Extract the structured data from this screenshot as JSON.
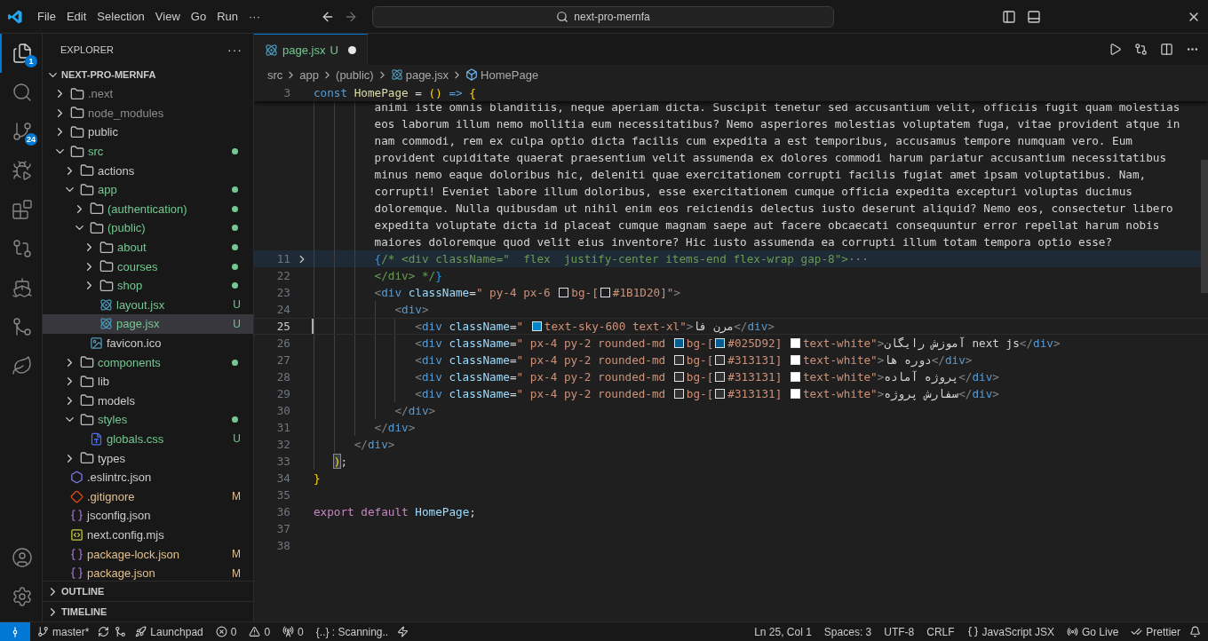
{
  "titlebar": {
    "menus": [
      "File",
      "Edit",
      "Selection",
      "View",
      "Go",
      "Run"
    ],
    "more": "···",
    "search": {
      "value": "next-pro-mernfa"
    }
  },
  "activity_bar": {
    "items": [
      {
        "kind": "explorer",
        "selected": true,
        "badge": "1"
      },
      {
        "kind": "search",
        "selected": false
      },
      {
        "kind": "source-control",
        "selected": false,
        "badge": "24"
      },
      {
        "kind": "run",
        "selected": false
      },
      {
        "kind": "extensions",
        "selected": false
      },
      {
        "kind": "remote",
        "selected": false
      },
      {
        "kind": "docker",
        "selected": false
      },
      {
        "kind": "git-graph",
        "selected": false
      },
      {
        "kind": "mongo",
        "selected": false
      }
    ],
    "bottom": [
      {
        "kind": "account",
        "selected": false
      },
      {
        "kind": "settings",
        "selected": false
      }
    ]
  },
  "sidebar": {
    "title": "EXPLORER",
    "more": "···",
    "project": {
      "name": "NEXT-PRO-MERNFA",
      "expanded": true
    },
    "tree": [
      {
        "name": ".next",
        "kind": "folder",
        "color": "#8c8c8c",
        "changes": false,
        "expanded": false,
        "selected": false
      },
      {
        "name": "node_modules",
        "kind": "folder",
        "color": "#8c8c8c",
        "changes": false,
        "expanded": false,
        "selected": false
      },
      {
        "name": "public",
        "kind": "folder",
        "color": "#cccccc",
        "changes": false,
        "expanded": false,
        "selected": false
      },
      {
        "name": "src",
        "kind": "folder",
        "color": "#73c991",
        "changes": true,
        "expanded": true,
        "selected": false,
        "children": [
          {
            "name": "actions",
            "kind": "folder",
            "color": "#cccccc",
            "changes": false,
            "expanded": false,
            "selected": false
          },
          {
            "name": "app",
            "kind": "folder",
            "color": "#73c991",
            "changes": true,
            "expanded": true,
            "selected": false,
            "children": [
              {
                "name": "(authentication)",
                "kind": "folder",
                "color": "#73c991",
                "changes": true,
                "expanded": false,
                "selected": false
              },
              {
                "name": "(public)",
                "kind": "folder",
                "color": "#73c991",
                "changes": true,
                "expanded": true,
                "selected": false,
                "children": [
                  {
                    "name": "about",
                    "kind": "folder",
                    "color": "#73c991",
                    "changes": true,
                    "expanded": false,
                    "selected": false
                  },
                  {
                    "name": "courses",
                    "kind": "folder",
                    "color": "#73c991",
                    "changes": true,
                    "expanded": false,
                    "selected": false
                  },
                  {
                    "name": "shop",
                    "kind": "folder",
                    "color": "#73c991",
                    "changes": true,
                    "expanded": false,
                    "selected": false
                  },
                  {
                    "name": "layout.jsx",
                    "kind": "react",
                    "color": "#73c991",
                    "changes": true,
                    "badge": "U",
                    "selected": false
                  },
                  {
                    "name": "page.jsx",
                    "kind": "react",
                    "color": "#73c991",
                    "changes": true,
                    "badge": "U",
                    "selected": true
                  }
                ]
              },
              {
                "name": "favicon.ico",
                "kind": "image",
                "color": "#cccccc",
                "changes": false,
                "selected": false
              }
            ]
          },
          {
            "name": "components",
            "kind": "folder",
            "color": "#73c991",
            "changes": true,
            "expanded": false,
            "selected": false
          },
          {
            "name": "lib",
            "kind": "folder",
            "color": "#cccccc",
            "changes": false,
            "expanded": false,
            "selected": false
          },
          {
            "name": "models",
            "kind": "folder",
            "color": "#cccccc",
            "changes": false,
            "expanded": false,
            "selected": false
          },
          {
            "name": "styles",
            "kind": "folder",
            "color": "#73c991",
            "changes": true,
            "expanded": true,
            "selected": false,
            "children": [
              {
                "name": "globals.css",
                "kind": "css",
                "color": "#73c991",
                "changes": true,
                "badge": "U",
                "selected": false
              }
            ]
          },
          {
            "name": "types",
            "kind": "folder",
            "color": "#cccccc",
            "changes": false,
            "expanded": false,
            "selected": false
          }
        ]
      },
      {
        "name": ".eslintrc.json",
        "kind": "eslint",
        "color": "#cccccc",
        "changes": false,
        "selected": false
      },
      {
        "name": ".gitignore",
        "kind": "git",
        "color": "#e2c08d",
        "changes": true,
        "badge": "M",
        "selected": false
      },
      {
        "name": "jsconfig.json",
        "kind": "json",
        "color": "#cccccc",
        "changes": false,
        "selected": false
      },
      {
        "name": "next.config.mjs",
        "kind": "js",
        "color": "#cccccc",
        "changes": false,
        "selected": false
      },
      {
        "name": "package-lock.json",
        "kind": "json",
        "color": "#e2c08d",
        "changes": true,
        "badge": "M",
        "selected": false
      },
      {
        "name": "package.json",
        "kind": "json",
        "color": "#e2c08d",
        "changes": true,
        "badge": "M",
        "selected": false
      }
    ],
    "sections": [
      {
        "title": "OUTLINE",
        "expanded": false
      },
      {
        "title": "TIMELINE",
        "expanded": false
      }
    ]
  },
  "editor": {
    "tabs": [
      {
        "name": "page.jsx",
        "kind": "react",
        "status": "U",
        "dirty": true,
        "selected": true
      }
    ],
    "breadcrumbs": [
      {
        "text": "src",
        "kind": "folder"
      },
      {
        "text": "app",
        "kind": "folder"
      },
      {
        "text": "(public)",
        "kind": "folder"
      },
      {
        "text": "page.jsx",
        "kind": "react"
      },
      {
        "text": "HomePage",
        "kind": "symbol"
      }
    ],
    "sticky_line": {
      "number": "3",
      "tokens": [
        {
          "kind": "keyword",
          "text": "const"
        },
        {
          "kind": "function",
          "text": " HomePage"
        },
        {
          "kind": "op",
          "text": " = "
        },
        {
          "kind": "bracket",
          "text": "()"
        },
        {
          "kind": "keyword",
          "text": " => "
        },
        {
          "kind": "bracket",
          "text": "{"
        }
      ]
    },
    "lines": [
      {
        "current": false,
        "folded": false,
        "tokens": [
          {
            "kind": "text",
            "text": "         animi iste omnis blanditiis, neque aperiam dicta. Suscipit tenetur sed accusantium velit, officiis fugit quam molestias"
          }
        ]
      },
      {
        "current": false,
        "folded": false,
        "tokens": [
          {
            "kind": "text",
            "text": "         eos laborum illum nemo mollitia eum necessitatibus? Nemo asperiores molestias voluptatem fuga, vitae provident atque in"
          }
        ]
      },
      {
        "current": false,
        "folded": false,
        "tokens": [
          {
            "kind": "text",
            "text": "         nam commodi, rem ex culpa optio dicta facilis cum expedita a est temporibus, accusamus tempore numquam vero. Eum"
          }
        ]
      },
      {
        "current": false,
        "folded": false,
        "tokens": [
          {
            "kind": "text",
            "text": "         provident cupiditate quaerat praesentium velit assumenda ex dolores commodi harum pariatur accusantium necessitatibus"
          }
        ]
      },
      {
        "current": false,
        "folded": false,
        "tokens": [
          {
            "kind": "text",
            "text": "         minus nemo eaque doloribus hic, deleniti quae exercitationem corrupti facilis fugiat amet ipsam voluptatibus. Nam,"
          }
        ]
      },
      {
        "current": false,
        "folded": false,
        "tokens": [
          {
            "kind": "text",
            "text": "         corrupti! Eveniet labore illum doloribus, esse exercitationem cumque officia expedita excepturi voluptas ducimus"
          }
        ]
      },
      {
        "current": false,
        "folded": false,
        "tokens": [
          {
            "kind": "text",
            "text": "         doloremque. Nulla quibusdam ut nihil enim eos reiciendis delectus iusto deserunt aliquid? Nemo eos, consectetur libero"
          }
        ]
      },
      {
        "current": false,
        "folded": false,
        "tokens": [
          {
            "kind": "text",
            "text": "         expedita voluptate dicta id placeat cumque magnam saepe aut facere obcaecati consequuntur error repellat harum nobis"
          }
        ]
      },
      {
        "current": false,
        "folded": false,
        "tokens": [
          {
            "kind": "text",
            "text": "         maiores doloremque quod velit eius inventore? Hic iusto assumenda ea corrupti illum totam tempora optio esse?"
          }
        ]
      },
      {
        "number": "11",
        "current": false,
        "folded": true,
        "tokens": [
          {
            "kind": "bracket2",
            "text": "         {"
          },
          {
            "kind": "comment",
            "text": "/* <div className=\"  flex  justify-center items-end flex-wrap gap-8\">"
          },
          {
            "kind": "fold",
            "text": "···"
          }
        ]
      },
      {
        "number": "22",
        "current": false,
        "folded": false,
        "tokens": [
          {
            "kind": "comment",
            "text": "         </div> */"
          },
          {
            "kind": "bracket2",
            "text": "}"
          }
        ]
      },
      {
        "number": "23",
        "current": false,
        "folded": false,
        "tokens": [
          {
            "kind": "angle",
            "text": "         <"
          },
          {
            "kind": "tag",
            "text": "div"
          },
          {
            "kind": "attr",
            "text": " className"
          },
          {
            "kind": "op",
            "text": "="
          },
          {
            "kind": "string",
            "text": "\" py-4 px-6 "
          },
          {
            "kind": "swatch",
            "color": "#1b1d20"
          },
          {
            "kind": "string",
            "text": "bg-["
          },
          {
            "kind": "swatch",
            "color": "#1b1d20"
          },
          {
            "kind": "string",
            "text": "#1B1D20]\""
          },
          {
            "kind": "angle",
            "text": ">"
          }
        ]
      },
      {
        "number": "24",
        "current": false,
        "folded": false,
        "tokens": [
          {
            "kind": "angle",
            "text": "            <"
          },
          {
            "kind": "tag",
            "text": "div"
          },
          {
            "kind": "angle",
            "text": ">"
          }
        ]
      },
      {
        "number": "25",
        "current": true,
        "folded": false,
        "tokens": [
          {
            "kind": "angle",
            "text": "               <"
          },
          {
            "kind": "tag",
            "text": "div"
          },
          {
            "kind": "attr",
            "text": " className"
          },
          {
            "kind": "op",
            "text": "="
          },
          {
            "kind": "string",
            "text": "\" "
          },
          {
            "kind": "swatch",
            "color": "#0284c7"
          },
          {
            "kind": "string",
            "text": "text-sky-600 text-xl\""
          },
          {
            "kind": "angle",
            "text": ">"
          },
          {
            "kind": "text",
            "text": "مرن فا"
          },
          {
            "kind": "angle",
            "text": "</"
          },
          {
            "kind": "tag",
            "text": "div"
          },
          {
            "kind": "angle",
            "text": ">"
          }
        ]
      },
      {
        "number": "26",
        "current": false,
        "folded": false,
        "tokens": [
          {
            "kind": "angle",
            "text": "               <"
          },
          {
            "kind": "tag",
            "text": "div"
          },
          {
            "kind": "attr",
            "text": " className"
          },
          {
            "kind": "op",
            "text": "="
          },
          {
            "kind": "string",
            "text": "\" px-4 py-2 rounded-md "
          },
          {
            "kind": "swatch",
            "color": "#025d92"
          },
          {
            "kind": "string",
            "text": "bg-["
          },
          {
            "kind": "swatch",
            "color": "#025d92"
          },
          {
            "kind": "string",
            "text": "#025D92] "
          },
          {
            "kind": "swatch",
            "color": "#ffffff"
          },
          {
            "kind": "string",
            "text": "text-white\""
          },
          {
            "kind": "angle",
            "text": ">"
          },
          {
            "kind": "text",
            "text": "آموزش رایگان next js"
          },
          {
            "kind": "angle",
            "text": "</"
          },
          {
            "kind": "tag",
            "text": "div"
          },
          {
            "kind": "angle",
            "text": ">"
          }
        ]
      },
      {
        "number": "27",
        "current": false,
        "folded": false,
        "tokens": [
          {
            "kind": "angle",
            "text": "               <"
          },
          {
            "kind": "tag",
            "text": "div"
          },
          {
            "kind": "attr",
            "text": " className"
          },
          {
            "kind": "op",
            "text": "="
          },
          {
            "kind": "string",
            "text": "\" px-4 py-2 rounded-md "
          },
          {
            "kind": "swatch",
            "color": "#313131"
          },
          {
            "kind": "string",
            "text": "bg-["
          },
          {
            "kind": "swatch",
            "color": "#313131"
          },
          {
            "kind": "string",
            "text": "#313131] "
          },
          {
            "kind": "swatch",
            "color": "#ffffff"
          },
          {
            "kind": "string",
            "text": "text-white\""
          },
          {
            "kind": "angle",
            "text": ">"
          },
          {
            "kind": "text",
            "text": "دوره ها"
          },
          {
            "kind": "angle",
            "text": "</"
          },
          {
            "kind": "tag",
            "text": "div"
          },
          {
            "kind": "angle",
            "text": ">"
          }
        ]
      },
      {
        "number": "28",
        "current": false,
        "folded": false,
        "tokens": [
          {
            "kind": "angle",
            "text": "               <"
          },
          {
            "kind": "tag",
            "text": "div"
          },
          {
            "kind": "attr",
            "text": " className"
          },
          {
            "kind": "op",
            "text": "="
          },
          {
            "kind": "string",
            "text": "\" px-4 py-2 rounded-md "
          },
          {
            "kind": "swatch",
            "color": "#313131"
          },
          {
            "kind": "string",
            "text": "bg-["
          },
          {
            "kind": "swatch",
            "color": "#313131"
          },
          {
            "kind": "string",
            "text": "#313131] "
          },
          {
            "kind": "swatch",
            "color": "#ffffff"
          },
          {
            "kind": "string",
            "text": "text-white\""
          },
          {
            "kind": "angle",
            "text": ">"
          },
          {
            "kind": "text",
            "text": "پروژه آماده"
          },
          {
            "kind": "angle",
            "text": "</"
          },
          {
            "kind": "tag",
            "text": "div"
          },
          {
            "kind": "angle",
            "text": ">"
          }
        ]
      },
      {
        "number": "29",
        "current": false,
        "folded": false,
        "tokens": [
          {
            "kind": "angle",
            "text": "               <"
          },
          {
            "kind": "tag",
            "text": "div"
          },
          {
            "kind": "attr",
            "text": " className"
          },
          {
            "kind": "op",
            "text": "="
          },
          {
            "kind": "string",
            "text": "\" px-4 py-2 rounded-md "
          },
          {
            "kind": "swatch",
            "color": "#313131"
          },
          {
            "kind": "string",
            "text": "bg-["
          },
          {
            "kind": "swatch",
            "color": "#313131"
          },
          {
            "kind": "string",
            "text": "#313131] "
          },
          {
            "kind": "swatch",
            "color": "#ffffff"
          },
          {
            "kind": "string",
            "text": "text-white\""
          },
          {
            "kind": "angle",
            "text": ">"
          },
          {
            "kind": "text",
            "text": "سفارش پروژه"
          },
          {
            "kind": "angle",
            "text": "</"
          },
          {
            "kind": "tag",
            "text": "div"
          },
          {
            "kind": "angle",
            "text": ">"
          }
        ]
      },
      {
        "number": "30",
        "current": false,
        "folded": false,
        "tokens": [
          {
            "kind": "angle",
            "text": "            </"
          },
          {
            "kind": "tag",
            "text": "div"
          },
          {
            "kind": "angle",
            "text": ">"
          }
        ]
      },
      {
        "number": "31",
        "current": false,
        "folded": false,
        "tokens": [
          {
            "kind": "angle",
            "text": "         </"
          },
          {
            "kind": "tag",
            "text": "div"
          },
          {
            "kind": "angle",
            "text": ">"
          }
        ]
      },
      {
        "number": "32",
        "current": false,
        "folded": false,
        "tokens": [
          {
            "kind": "angle",
            "text": "      </"
          },
          {
            "kind": "tag",
            "text": "div"
          },
          {
            "kind": "angle",
            "text": ">"
          }
        ]
      },
      {
        "number": "33",
        "current": false,
        "folded": false,
        "tokens": [
          {
            "kind": "bracket_match",
            "text": "   )"
          },
          {
            "kind": "plain",
            "text": ";"
          }
        ]
      },
      {
        "number": "34",
        "current": false,
        "folded": false,
        "tokens": [
          {
            "kind": "bracket",
            "text": "}"
          }
        ]
      },
      {
        "number": "35",
        "current": false,
        "folded": false
      },
      {
        "number": "36",
        "current": false,
        "folded": false,
        "tokens": [
          {
            "kind": "control",
            "text": "export default"
          },
          {
            "kind": "variable",
            "text": " HomePage"
          },
          {
            "kind": "plain",
            "text": ";"
          }
        ]
      },
      {
        "number": "37",
        "current": false,
        "folded": false
      },
      {
        "number": "38",
        "current": false,
        "folded": false
      }
    ]
  },
  "status_bar": {
    "left": [
      {
        "kind": "remote"
      },
      {
        "kind": "branch",
        "text": "master*"
      },
      {
        "kind": "sync"
      },
      {
        "kind": "graph"
      },
      {
        "kind": "launchpad",
        "text": "Launchpad"
      },
      {
        "kind": "errors",
        "text": "0"
      },
      {
        "kind": "warnings",
        "text": "0"
      },
      {
        "kind": "ports",
        "text": "0"
      },
      {
        "kind": "text",
        "text": "{..} : Scanning.."
      },
      {
        "kind": "bolt"
      }
    ],
    "right": [
      {
        "kind": "text",
        "text": "Ln 25, Col 1"
      },
      {
        "kind": "text",
        "text": "Spaces: 3"
      },
      {
        "kind": "text",
        "text": "UTF-8"
      },
      {
        "kind": "text",
        "text": "CRLF"
      },
      {
        "kind": "language",
        "text": "JavaScript JSX"
      },
      {
        "kind": "golive",
        "text": "Go Live"
      },
      {
        "kind": "prettier",
        "text": "Prettier"
      },
      {
        "kind": "bell"
      }
    ]
  }
}
